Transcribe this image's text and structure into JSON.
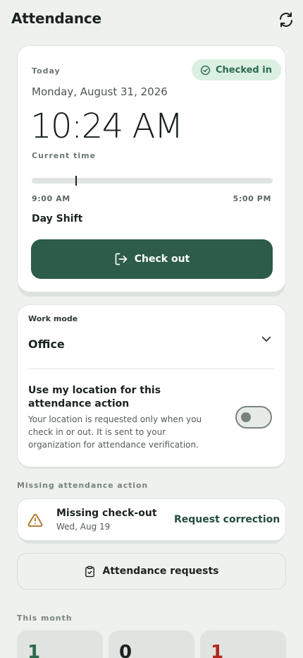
{
  "header": {
    "title": "Attendance",
    "refresh_icon": "refresh-icon"
  },
  "today": {
    "eyebrow": "Today",
    "status_badge": "Checked in",
    "date": "Monday, August 31, 2026",
    "time": "10:24 AM",
    "time_caption": "Current time",
    "shift_start": "9:00 AM",
    "shift_end": "5:00 PM",
    "shift_progress": 0.18,
    "shift_name": "Day Shift",
    "checkout_label": "Check out"
  },
  "work_mode": {
    "label": "Work mode",
    "value": "Office",
    "location_title": "Use my location for this attendance action",
    "location_description": "Your location is requested only when you check in or out. It is sent to your organization for attendance verification.",
    "location_enabled": false
  },
  "missing": {
    "section_label": "Missing attendance action",
    "items": [
      {
        "title": "Missing check-out",
        "date": "Wed, Aug 19",
        "action": "Request correction"
      }
    ]
  },
  "requests_button": "Attendance requests",
  "this_month": {
    "section_label": "This month",
    "stats": [
      {
        "value": "1",
        "color": "#2b6b4c"
      },
      {
        "value": "0",
        "color": "#1b221f"
      },
      {
        "value": "1",
        "color": "#b3261e"
      }
    ]
  },
  "colors": {
    "accent": "#2d5c4a",
    "background": "#eef1ee",
    "success_bg": "#dcefe3",
    "warning": "#a86a10"
  }
}
